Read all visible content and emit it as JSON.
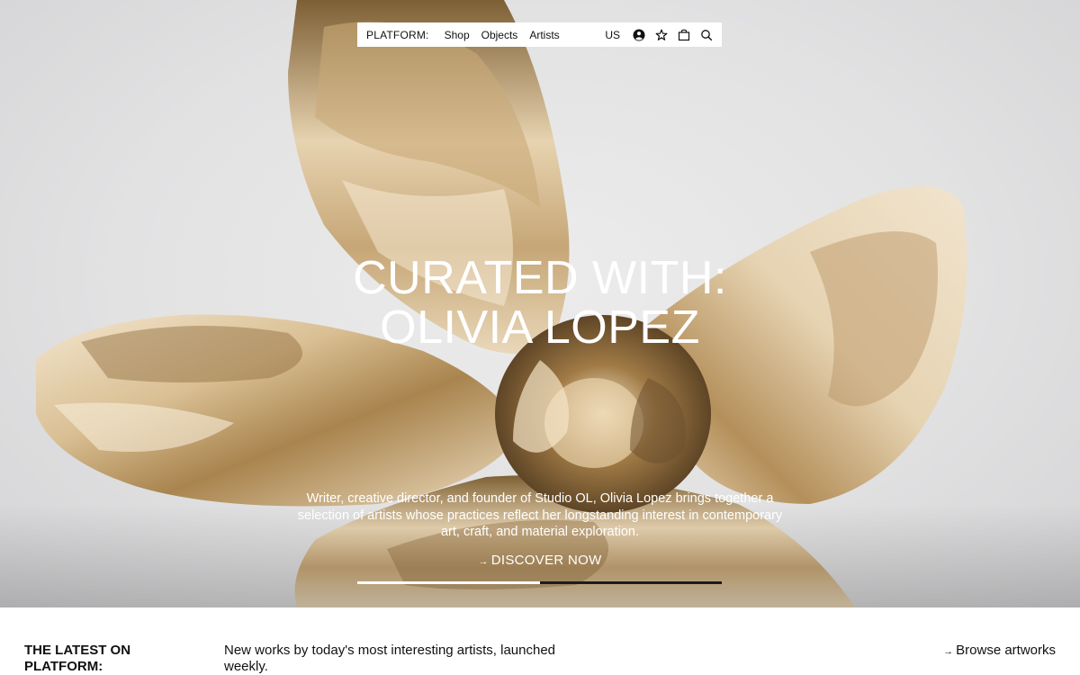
{
  "nav": {
    "brand": "PLATFORM:",
    "links": [
      "Shop",
      "Objects",
      "Artists"
    ],
    "region": "US",
    "icons": [
      "account-icon",
      "favorites-star-icon",
      "shopping-bag-icon",
      "search-icon"
    ]
  },
  "hero": {
    "title_line1": "CURATED WITH:",
    "title_line2": "OLIVIA LOPEZ",
    "description": "Writer, creative director, and founder of Studio OL, Olivia Lopez brings together a selection of artists whose practices reflect her longstanding interest in contemporary art, craft, and material exploration.",
    "cta_arrow": "→",
    "cta_label": "DISCOVER NOW",
    "slideshow_progress": 0.5
  },
  "latest": {
    "heading": "THE LATEST ON PLATFORM:",
    "description": "New works by today's most interesting artists, launched weekly.",
    "browse_arrow": "→",
    "browse_label": "Browse artworks"
  },
  "colors": {
    "hero_background": "#e2e2e3",
    "gold_light": "#eddcc0",
    "gold_dark": "#8a6a3c",
    "text_dark": "#111111"
  }
}
